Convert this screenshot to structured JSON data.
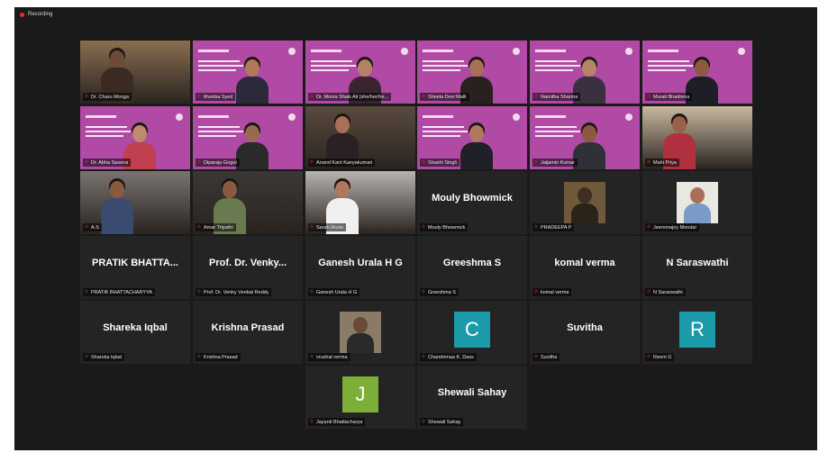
{
  "recording": {
    "label": "Recording"
  },
  "tiles": [
    {
      "kind": "cam",
      "name": "Dr. Charu Monga",
      "speaker": true,
      "bg": "#8a6e50",
      "skin": "#6e4a36",
      "shirt": "#3b2a22"
    },
    {
      "kind": "pink",
      "name": "Mumba Syed",
      "skin": "#b07a5a",
      "shirt": "#2a2a3a"
    },
    {
      "kind": "pink",
      "name": "Dr. Monia Shaik Ali (she/her/he...",
      "skin": "#b5806a",
      "shirt": "#3a2430"
    },
    {
      "kind": "pink",
      "name": "Sheela Devi Malli",
      "skin": "#a87058",
      "shirt": "#2a2020"
    },
    {
      "kind": "pink",
      "name": "Namitha Sharma",
      "skin": "#b88468",
      "shirt": "#3b3040"
    },
    {
      "kind": "pink",
      "name": "Murali Bhadrena",
      "skin": "#8c5a42",
      "shirt": "#1e1e26"
    },
    {
      "kind": "pink",
      "name": "Dr. Abha Saxena",
      "skin": "#c08a70",
      "shirt": "#c04050"
    },
    {
      "kind": "pink",
      "name": "Diparaju Gogoi",
      "skin": "#9a6a50",
      "shirt": "#2a2a2a"
    },
    {
      "kind": "cam",
      "name": "Anand Kant Kanyakumari",
      "bg": "#5a4a3e",
      "skin": "#a87058",
      "shirt": "#2a2222"
    },
    {
      "kind": "pink",
      "name": "Shashi Singh",
      "skin": "#b07860",
      "shirt": "#202028"
    },
    {
      "kind": "pink",
      "name": "Jaijamin Kumar",
      "skin": "#8a5a40",
      "shirt": "#303038"
    },
    {
      "kind": "cam",
      "name": "Mahi Priya",
      "bg": "#c8b8a0",
      "skin": "#9a6048",
      "shirt": "#b03040"
    },
    {
      "kind": "cam",
      "name": "A.S",
      "bg": "#7a7470",
      "skin": "#8a5a40",
      "shirt": "#3a4a70"
    },
    {
      "kind": "cam",
      "name": "Amar Tripathi",
      "bg": "#3a3836",
      "skin": "#8a5a40",
      "shirt": "#6a7a50"
    },
    {
      "kind": "cam",
      "name": "Sarah Rozie",
      "bg": "#b8b4b0",
      "skin": "#b07860",
      "shirt": "#f0f0f0"
    },
    {
      "kind": "text",
      "name": "Mouly Bhowmick",
      "display": "Mouly Bhowmick"
    },
    {
      "kind": "photo",
      "name": "PRADEEPA P",
      "bg": "#6e5a3a",
      "skin": "#3e2e20",
      "shirt": "#2a2418"
    },
    {
      "kind": "photo",
      "name": "Jeemmajoy Mondal",
      "bg": "#e8e8e0",
      "skin": "#a87058",
      "shirt": "#7a9ac8"
    },
    {
      "kind": "text",
      "name": "PRATIK BHATTACHARYYA",
      "display": "PRATIK  BHATTA..."
    },
    {
      "kind": "text",
      "name": "Prof. Dr. Venky Venkat Reddy",
      "display": "Prof. Dr. Venky..."
    },
    {
      "kind": "text",
      "name": "Ganesh Urala H G",
      "display": "Ganesh Urala H G"
    },
    {
      "kind": "text",
      "name": "Greeshma S",
      "display": "Greeshma S"
    },
    {
      "kind": "text",
      "name": "komal verma",
      "display": "komal verma"
    },
    {
      "kind": "text",
      "name": "N Saraswathi",
      "display": "N Saraswathi"
    },
    {
      "kind": "text",
      "name": "Shareka Iqbal",
      "display": "Shareka Iqbal"
    },
    {
      "kind": "text",
      "name": "Krishna Prasad",
      "display": "Krishna Prasad"
    },
    {
      "kind": "photo",
      "name": "vrushal verma",
      "bg": "#8a7a68",
      "skin": "#6a4a36",
      "shirt": "#2a2a2a"
    },
    {
      "kind": "avatar",
      "name": "Chandrimaa K. Dass",
      "letter": "C",
      "color": "#1b9aaa"
    },
    {
      "kind": "text",
      "name": "Suvitha",
      "display": "Suvitha"
    },
    {
      "kind": "avatar",
      "name": "Reem G",
      "letter": "R",
      "color": "#1b9aaa"
    },
    {
      "kind": "avatar",
      "name": "Jayanti Bhattacharya",
      "letter": "J",
      "color": "#7cae3a"
    },
    {
      "kind": "text",
      "name": "Shewali Sahay",
      "display": "Shewali Sahay"
    }
  ]
}
